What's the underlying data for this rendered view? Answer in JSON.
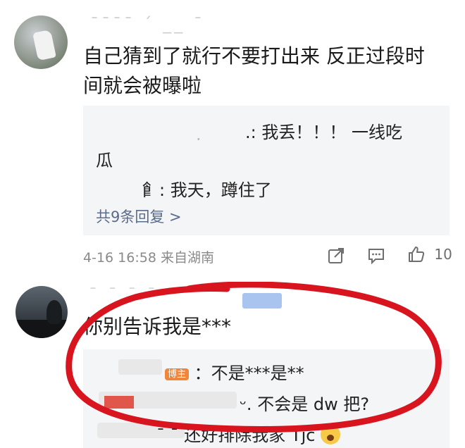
{
  "comment1": {
    "username_masked": "ˉˉˉˉ ˊ __ ˉ",
    "text_line1": "自己猜到了就行不要打出来 反正过段时",
    "text_line2": "间就会被曝啦",
    "replies": [
      {
        "user_masked": ".:",
        "text": "我丢！！！ 一线吃"
      },
      {
        "user_masked": "",
        "text": "瓜"
      },
      {
        "user_masked": "⻞:",
        "text": "我天，蹲住了"
      }
    ],
    "more_replies": "共9条回复 >",
    "timestamp": "4-16 16:58 来自湖南",
    "like_count": "10"
  },
  "comment2": {
    "text": "你别告诉我是***",
    "replies": [
      {
        "badge": "博主",
        "text": "：不是***是**"
      },
      {
        "user_masked": "ᵕ.",
        "text": "不会是 dw 把?"
      },
      {
        "user_masked": "ˉ ˉ",
        "text": "还好排除我家 Tjc"
      }
    ]
  },
  "colors": {
    "link": "#5b6b8c",
    "meta": "#8a8a8a",
    "reply_bg": "#f4f5f7",
    "annotation_red": "#d8141e",
    "blogger_badge": "#f0863c"
  },
  "icons": [
    "share-icon",
    "comment-icon",
    "like-icon",
    "emoji-scream-icon"
  ]
}
